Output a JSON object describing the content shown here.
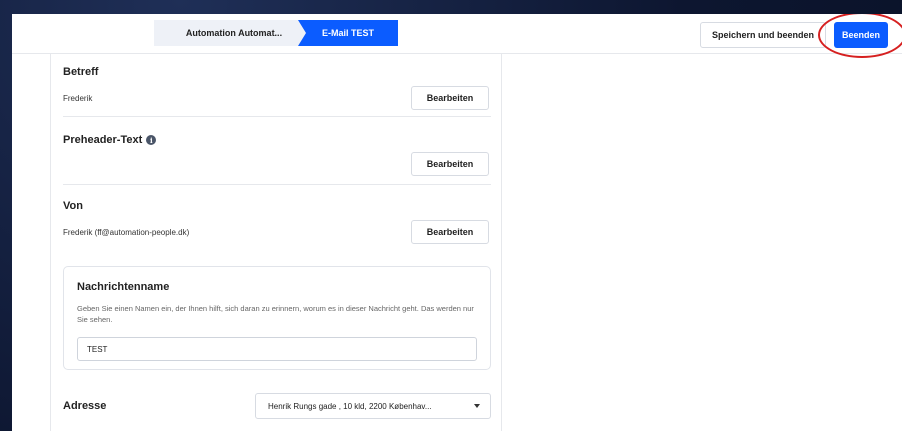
{
  "breadcrumb": {
    "step1": "Automation Automat...",
    "step2": "E-Mail TEST"
  },
  "header": {
    "save_label": "Speichern und beenden",
    "end_label": "Beenden"
  },
  "sections": {
    "subject": {
      "title": "Betreff",
      "value": "Frederik",
      "edit_label": "Bearbeiten"
    },
    "preheader": {
      "title": "Preheader-Text",
      "info_icon": "i",
      "edit_label": "Bearbeiten"
    },
    "from": {
      "title": "Von",
      "value": "Frederik (ff@automation-people.dk)",
      "edit_label": "Bearbeiten"
    }
  },
  "message_name": {
    "title": "Nachrichtenname",
    "help": "Geben Sie einen Namen ein, der Ihnen hilft, sich daran zu erinnern, worum es in dieser Nachricht geht. Das werden nur Sie sehen.",
    "value": "TEST"
  },
  "address": {
    "label": "Adresse",
    "selected": "Henrik Rungs gade , 10 kld, 2200 Københav..."
  },
  "colors": {
    "primary": "#0b5cff",
    "highlight_ellipse": "#d62020",
    "breadcrumb_inactive": "#eef1f7"
  }
}
